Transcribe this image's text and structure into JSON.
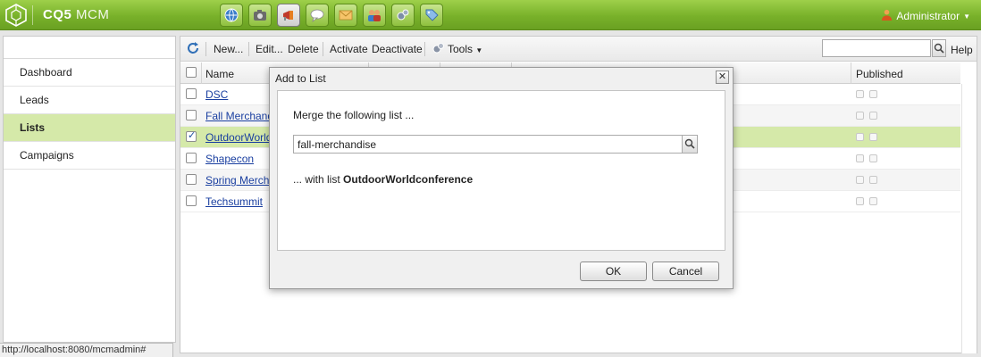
{
  "app": {
    "brand_bold": "CQ5",
    "brand_light": "MCM",
    "user": "Administrator",
    "nav_icons": [
      "globe-icon",
      "camera-icon",
      "megaphone-icon",
      "chat-icon",
      "mail-icon",
      "people-icon",
      "gears-icon",
      "tag-icon"
    ],
    "active_nav_icon": "megaphone-icon",
    "accent_color": "#7db52f"
  },
  "sidebar": {
    "items": [
      {
        "label": "Dashboard"
      },
      {
        "label": "Leads"
      },
      {
        "label": "Lists",
        "selected": true
      },
      {
        "label": "Campaigns"
      }
    ]
  },
  "toolbar": {
    "new": "New...",
    "edit": "Edit...",
    "delete": "Delete",
    "activate": "Activate",
    "deactivate": "Deactivate",
    "tools": "Tools",
    "help": "Help",
    "search_value": ""
  },
  "grid": {
    "headers": {
      "name": "Name",
      "published": "Published"
    },
    "rows": [
      {
        "name": "DSC",
        "checked": false
      },
      {
        "name": "Fall Merchandis",
        "checked": false
      },
      {
        "name": "OutdoorWorldc",
        "checked": true
      },
      {
        "name": "Shapecon",
        "checked": false
      },
      {
        "name": "Spring Merchan",
        "checked": false
      },
      {
        "name": "Techsummit",
        "checked": false
      }
    ]
  },
  "dialog": {
    "title": "Add to List",
    "message": "Merge the following list ...",
    "list_value": "fall-merchandise",
    "with_prefix": "... with list",
    "with_list": "OutdoorWorldconference",
    "ok": "OK",
    "cancel": "Cancel"
  },
  "status": {
    "url": "http://localhost:8080/mcmadmin#"
  }
}
